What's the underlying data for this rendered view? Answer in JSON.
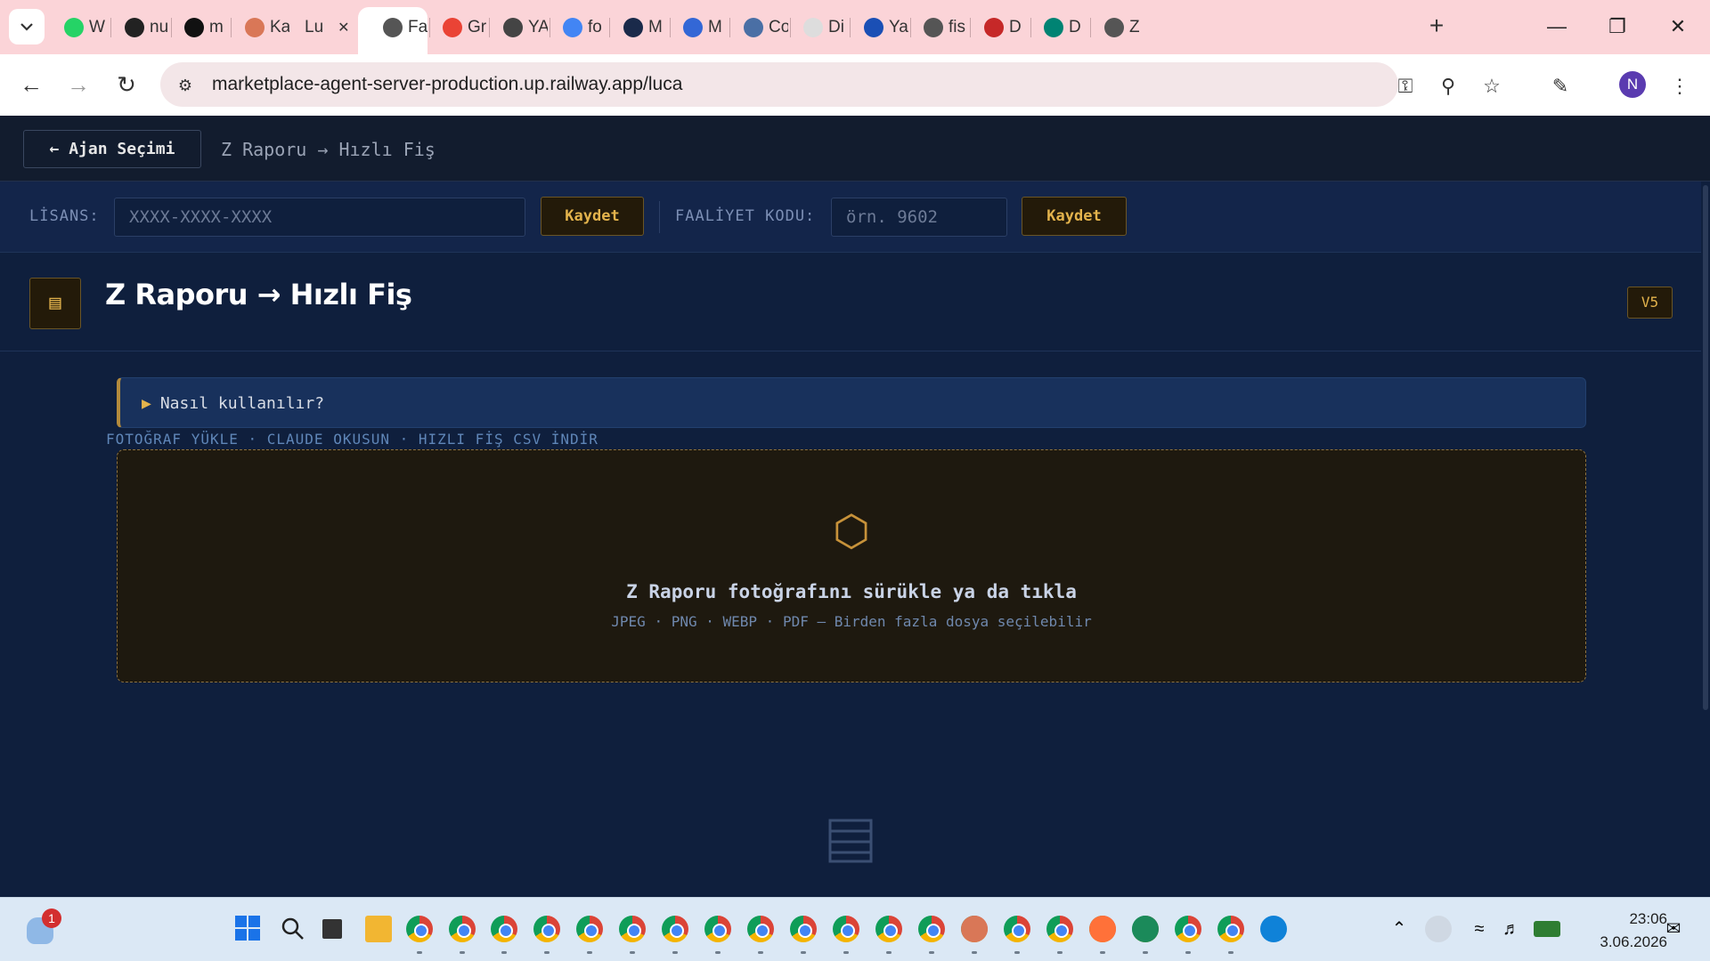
{
  "browser": {
    "tabs": [
      {
        "label": "W",
        "icon": "whatsapp-icon",
        "color": "#25d366"
      },
      {
        "label": "nu",
        "icon": "github-icon",
        "color": "#222222"
      },
      {
        "label": "m",
        "icon": "medium-icon",
        "color": "#111111"
      },
      {
        "label": "Ka",
        "icon": "claude-icon",
        "color": "#d97757"
      },
      {
        "label": "Lu",
        "icon": "",
        "color": ""
      },
      {
        "label": "Fa",
        "icon": "globe-icon",
        "color": "#555555"
      },
      {
        "label": "Gr",
        "icon": "gmail-icon",
        "color": "#ea4335"
      },
      {
        "label": "YA",
        "icon": "tool-icon",
        "color": "#444444"
      },
      {
        "label": "fo",
        "icon": "google-icon",
        "color": "#4285f4"
      },
      {
        "label": "M",
        "icon": "m-icon",
        "color": "#1a2a4a"
      },
      {
        "label": "M",
        "icon": "site-icon",
        "color": "#3367d6"
      },
      {
        "label": "Co",
        "icon": "site-icon",
        "color": "#4a6fa5"
      },
      {
        "label": "Di",
        "icon": "f-icon",
        "color": "#dddddd"
      },
      {
        "label": "Ya",
        "icon": "site-icon",
        "color": "#1a4fb5"
      },
      {
        "label": "fis",
        "icon": "globe-icon",
        "color": "#555555"
      },
      {
        "label": "D",
        "icon": "b-icon",
        "color": "#c62828"
      },
      {
        "label": "D",
        "icon": "bing-icon",
        "color": "#008373"
      },
      {
        "label": "Z",
        "icon": "globe-icon",
        "color": "#555555"
      }
    ],
    "url": "marketplace-agent-server-production.up.railway.app/luca",
    "profile_initial": "N"
  },
  "app": {
    "nav": {
      "back_label": "← Ajan Seçimi",
      "crumb": "Z Raporu → Hızlı Fiş"
    },
    "license_bar": {
      "license_label": "LİSANS:",
      "license_placeholder": "XXXX-XXXX-XXXX",
      "save_label": "Kaydet",
      "activity_label": "FAALİYET KODU:",
      "activity_placeholder": "örn. 9602"
    },
    "header": {
      "title": "Z Raporu → Hızlı Fiş",
      "subtitle": "FOTOĞRAF YÜKLE · CLAUDE OKUSUN · HIZLI FİŞ CSV İNDİR",
      "version": "V5"
    },
    "howto": {
      "label": "Nasıl kullanılır?"
    },
    "dropzone": {
      "title": "Z Raporu fotoğrafını sürükle ya da tıkla",
      "subtitle": "JPEG · PNG · WEBP · PDF — Birden fazla dosya seçilebilir"
    },
    "colors": {
      "accent": "#e3b34c",
      "background": "#0f1f3d"
    }
  },
  "taskbar": {
    "weather_badge": "1",
    "time": "23:06",
    "date": "3.06.2026"
  }
}
